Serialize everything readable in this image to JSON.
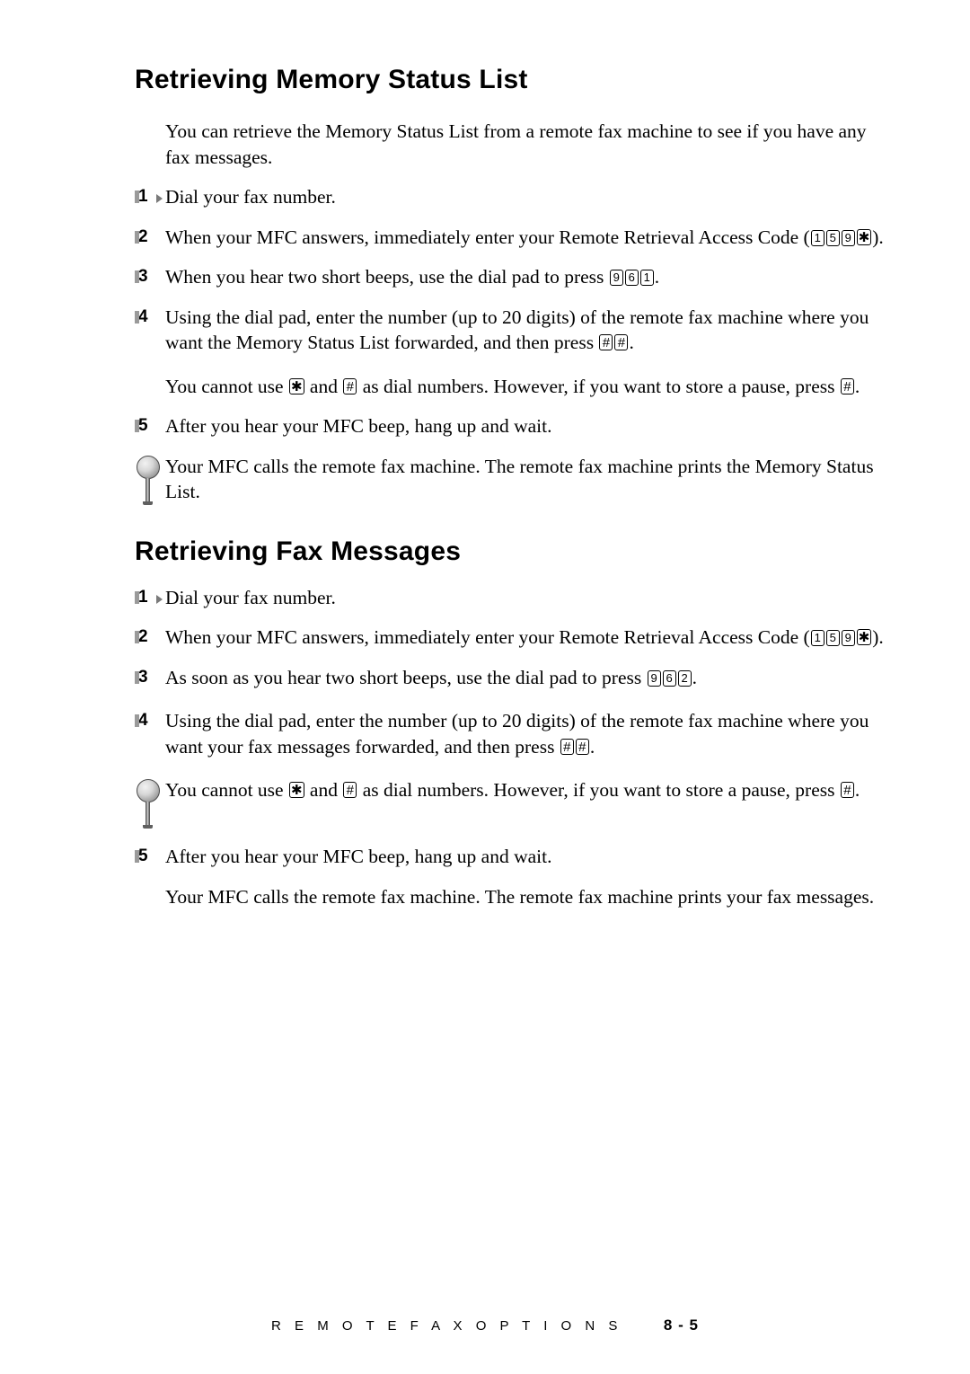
{
  "document": {
    "sections": [
      {
        "heading": "Retrieving Memory Status List",
        "intro": "You can retrieve the Memory Status List from a remote fax machine to see if you have any fax messages.",
        "steps": [
          {
            "number": "1",
            "text_parts": [
              {
                "type": "text",
                "value": "Dial your fax number."
              }
            ]
          },
          {
            "number": "2",
            "text_parts": [
              {
                "type": "text",
                "value": "When your MFC answers, immediately enter your Remote Retrieval Access Code ("
              },
              {
                "type": "key",
                "value": "1"
              },
              {
                "type": "key",
                "value": "5"
              },
              {
                "type": "key",
                "value": "9"
              },
              {
                "type": "key",
                "value": "✱"
              },
              {
                "type": "text",
                "value": ")."
              }
            ]
          },
          {
            "number": "3",
            "text_parts": [
              {
                "type": "text",
                "value": "When you hear two short beeps, use the dial pad to press "
              },
              {
                "type": "key",
                "value": "9"
              },
              {
                "type": "key",
                "value": "6"
              },
              {
                "type": "key",
                "value": "1"
              },
              {
                "type": "text",
                "value": "."
              }
            ]
          },
          {
            "number": "4",
            "text_parts": [
              {
                "type": "text",
                "value": "Using the dial pad, enter the number (up to 20 digits) of the remote fax machine where you want the Memory Status List forwarded, and then press "
              },
              {
                "type": "key",
                "value": "#"
              },
              {
                "type": "key",
                "value": "#"
              },
              {
                "type": "text",
                "value": "."
              }
            ]
          }
        ],
        "note_after_step4": {
          "text_parts": [
            {
              "type": "text",
              "value": "You cannot use "
            },
            {
              "type": "key",
              "value": "✱"
            },
            {
              "type": "text",
              "value": " and "
            },
            {
              "type": "key",
              "value": "#"
            },
            {
              "type": "text",
              "value": " as dial numbers. However, if you want to store a pause, press "
            },
            {
              "type": "key",
              "value": "#"
            },
            {
              "type": "text",
              "value": "."
            }
          ]
        },
        "step5": {
          "number": "5",
          "text_parts": [
            {
              "type": "text",
              "value": "After you hear your MFC beep, hang up and wait."
            }
          ]
        },
        "bulb_note": "Your MFC calls the remote fax machine. The remote fax machine prints the Memory Status List."
      },
      {
        "heading": "Retrieving Fax Messages",
        "steps": [
          {
            "number": "1",
            "text_parts": [
              {
                "type": "text",
                "value": "Dial your fax number."
              }
            ]
          },
          {
            "number": "2",
            "text_parts": [
              {
                "type": "text",
                "value": "When your MFC answers, immediately enter your Remote Retrieval Access Code ("
              },
              {
                "type": "key",
                "value": "1"
              },
              {
                "type": "key",
                "value": "5"
              },
              {
                "type": "key",
                "value": "9"
              },
              {
                "type": "key",
                "value": "✱"
              },
              {
                "type": "text",
                "value": ")."
              }
            ]
          },
          {
            "number": "3",
            "text_parts": [
              {
                "type": "text",
                "value": "As soon as you hear two short beeps, use the dial pad to press "
              },
              {
                "type": "key",
                "value": "9"
              },
              {
                "type": "key",
                "value": "6"
              },
              {
                "type": "key",
                "value": "2"
              },
              {
                "type": "text",
                "value": "."
              }
            ]
          },
          {
            "number": "4",
            "text_parts": [
              {
                "type": "text",
                "value": "Using the dial pad, enter the number (up to 20 digits) of the remote fax machine where you want your fax messages forwarded, and then press "
              },
              {
                "type": "key",
                "value": "#"
              },
              {
                "type": "key",
                "value": "#"
              },
              {
                "type": "text",
                "value": "."
              }
            ]
          }
        ],
        "bulb_note_parts": [
          {
            "type": "text",
            "value": "You cannot use "
          },
          {
            "type": "key",
            "value": "✱"
          },
          {
            "type": "text",
            "value": " and "
          },
          {
            "type": "key",
            "value": "#"
          },
          {
            "type": "text",
            "value": " as dial numbers.  However, if you want to store a pause, press "
          },
          {
            "type": "key",
            "value": "#"
          },
          {
            "type": "text",
            "value": "."
          }
        ],
        "step5": {
          "number": "5",
          "text_parts": [
            {
              "type": "text",
              "value": "After you hear your MFC beep, hang up and wait."
            }
          ]
        },
        "closing": "Your MFC calls the remote fax machine. The remote fax machine prints your fax messages."
      }
    ]
  },
  "footer": {
    "title": "R E M O T E    F A X    O P T I O N S",
    "page": "8 - 5"
  }
}
